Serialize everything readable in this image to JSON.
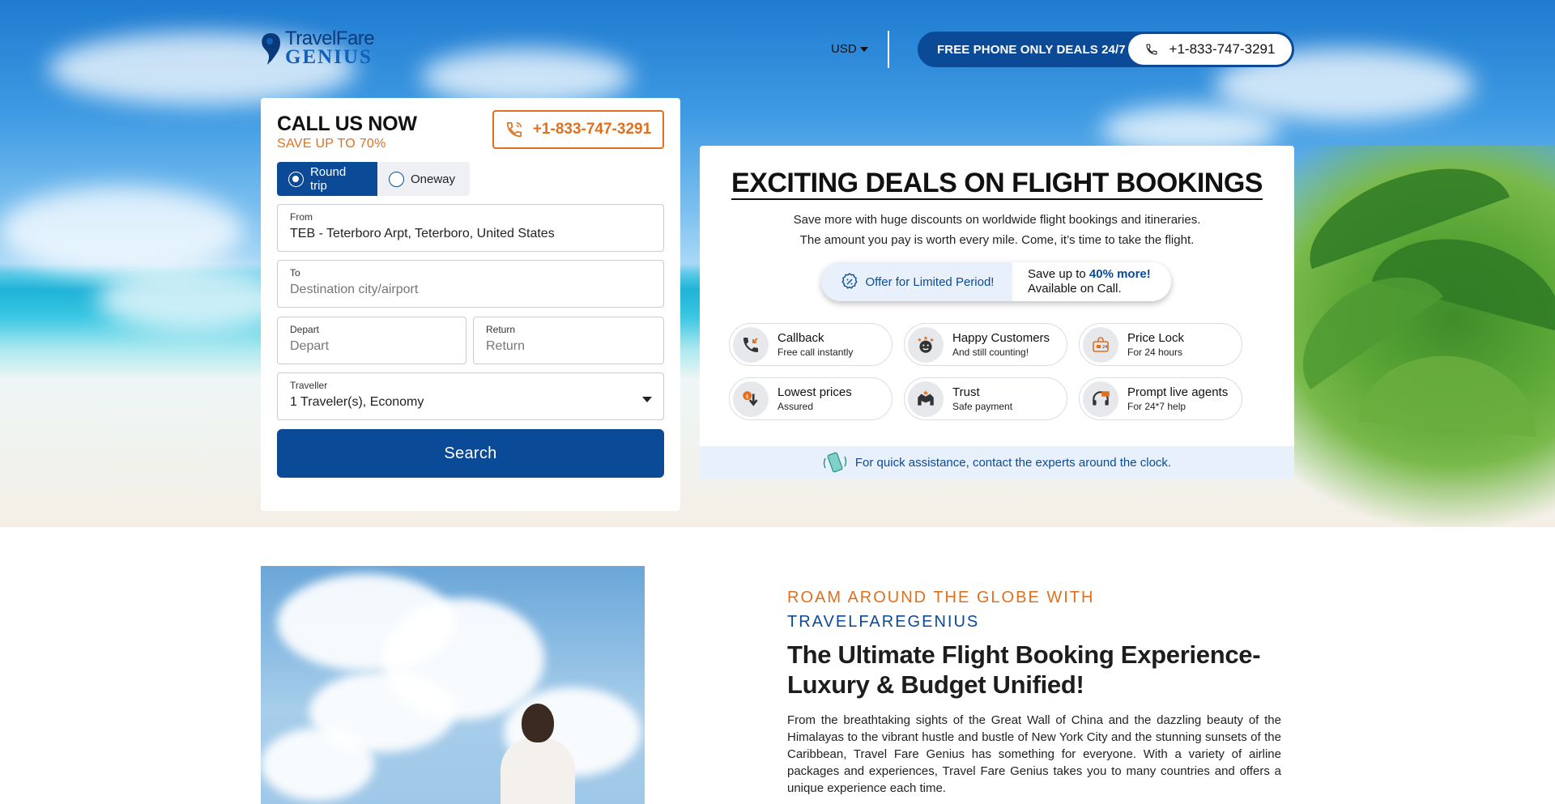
{
  "header": {
    "logo_line1": "TravelFare",
    "logo_line2": "GENIUS",
    "currency": "USD",
    "phone_label": "FREE PHONE ONLY DEALS 24/7",
    "phone_number": "+1-833-747-3291"
  },
  "booking": {
    "call_title": "CALL US NOW",
    "call_sub": "SAVE UP TO 70%",
    "call_number": "+1-833-747-3291",
    "trip_types": [
      "Round trip",
      "Oneway"
    ],
    "selected_trip": "Round trip",
    "from": {
      "label": "From",
      "value": "TEB - Teterboro Arpt, Teterboro, United States"
    },
    "to": {
      "label": "To",
      "placeholder": "Destination city/airport"
    },
    "depart": {
      "label": "Depart",
      "placeholder": "Depart"
    },
    "return": {
      "label": "Return",
      "placeholder": "Return"
    },
    "traveller": {
      "label": "Traveller",
      "value": "1 Traveler(s), Economy"
    },
    "search_label": "Search"
  },
  "deals": {
    "title": "EXCITING DEALS ON FLIGHT BOOKINGS",
    "desc_line1": "Save more with huge discounts on worldwide flight bookings and itineraries.",
    "desc_line2": "The amount you pay is worth every mile. Come, it’s time to take the flight.",
    "offer_left": "Offer for Limited Period!",
    "offer_prefix": "Save up to ",
    "offer_bold": "40% more!",
    "offer_line2": "Available on Call.",
    "features": [
      {
        "title": "Callback",
        "sub": "Free call instantly",
        "icon": "phone-callback-icon"
      },
      {
        "title": "Happy Customers",
        "sub": "And still counting!",
        "icon": "smiley-stars-icon"
      },
      {
        "title": "Price Lock",
        "sub": "For 24 hours",
        "icon": "price-lock-icon"
      },
      {
        "title": "Lowest prices",
        "sub": "Assured",
        "icon": "lowest-price-icon"
      },
      {
        "title": "Trust",
        "sub": "Safe payment",
        "icon": "handshake-icon"
      },
      {
        "title": "Prompt live agents",
        "sub": "For 24*7 help",
        "icon": "headset-icon"
      }
    ],
    "assist": "For quick assistance, contact the experts around the clock."
  },
  "about": {
    "eyebrow_1": "ROAM AROUND THE GLOBE WITH",
    "eyebrow_2": "TRAVELFAREGENIUS",
    "heading": "The Ultimate Flight Booking Experience- Luxury & Budget Unified!",
    "paragraph": "From the breathtaking sights of the Great Wall of China and the dazzling beauty of the Himalayas to the vibrant hustle and bustle of New York City and the stunning sunsets of the Caribbean, Travel Fare Genius has something for everyone. With a variety of airline packages and experiences, Travel Fare Genius takes you to many countries and offers a unique experience each time."
  },
  "colors": {
    "brand_blue": "#0b4a96",
    "accent_orange": "#e0701e",
    "light_blue": "#e8f1fb"
  }
}
